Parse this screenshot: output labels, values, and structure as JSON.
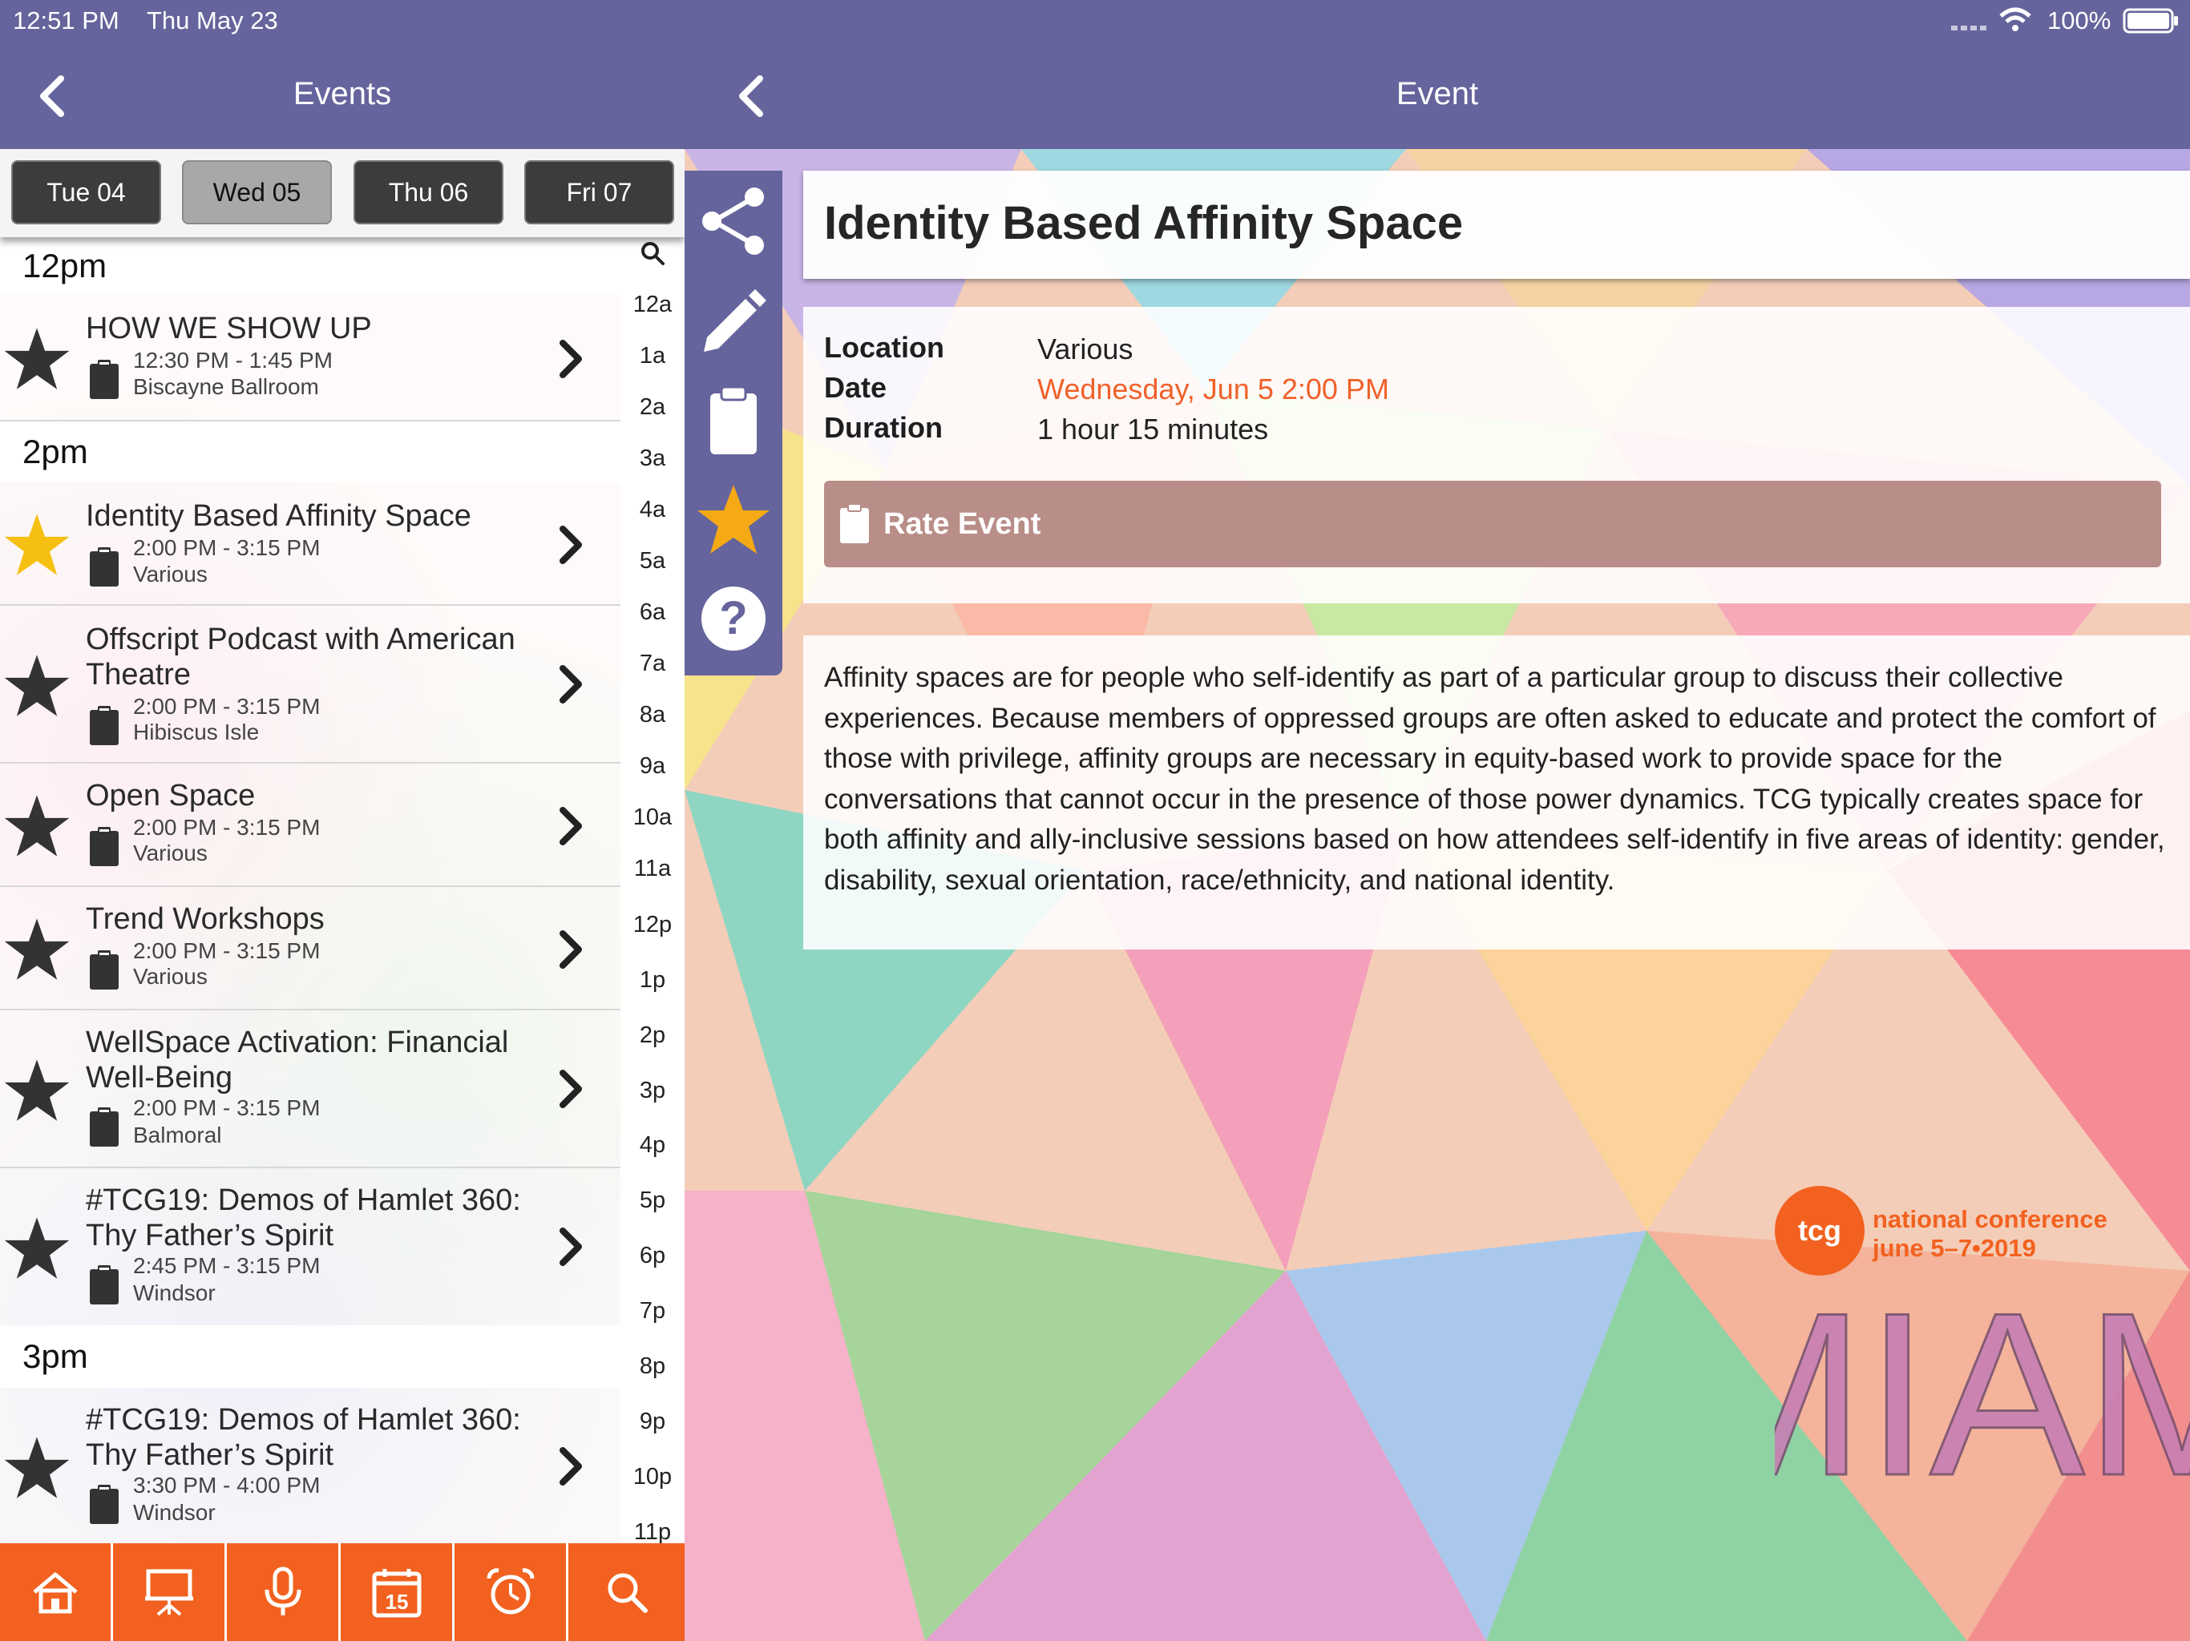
{
  "status_bar": {
    "time": "12:51 PM",
    "date": "Thu May 23",
    "battery": "100%"
  },
  "left_header": {
    "title": "Events"
  },
  "day_tabs": [
    {
      "label": "Tue 04",
      "active": false
    },
    {
      "label": "Wed 05",
      "active": true
    },
    {
      "label": "Thu 06",
      "active": false
    },
    {
      "label": "Fri 07",
      "active": false
    }
  ],
  "sections": [
    {
      "header": "12pm",
      "events": [
        {
          "title": "HOW WE SHOW UP",
          "time": "12:30 PM - 1:45 PM",
          "location": "Biscayne Ballroom",
          "starred": false
        }
      ]
    },
    {
      "header": "2pm",
      "events": [
        {
          "title": "Identity Based Affinity Space",
          "time": "2:00 PM - 3:15 PM",
          "location": "Various",
          "starred": true
        },
        {
          "title": "Offscript Podcast with American Theatre",
          "time": "2:00 PM - 3:15 PM",
          "location": "Hibiscus Isle",
          "starred": false
        },
        {
          "title": "Open Space",
          "time": "2:00 PM - 3:15 PM",
          "location": "Various",
          "starred": false
        },
        {
          "title": "Trend Workshops",
          "time": "2:00 PM - 3:15 PM",
          "location": "Various",
          "starred": false
        },
        {
          "title": "WellSpace Activation: Financial Well-Being",
          "time": "2:00 PM - 3:15 PM",
          "location": "Balmoral",
          "starred": false
        },
        {
          "title": "#TCG19: Demos of Hamlet 360: Thy Father’s Spirit",
          "time": "2:45 PM - 3:15 PM",
          "location": "Windsor",
          "starred": false
        }
      ]
    },
    {
      "header": "3pm",
      "events": [
        {
          "title": "#TCG19: Demos of Hamlet 360: Thy Father’s Spirit",
          "time": "3:30 PM - 4:00 PM",
          "location": "Windsor",
          "starred": false
        }
      ]
    }
  ],
  "time_index": [
    "12a",
    "1a",
    "2a",
    "3a",
    "4a",
    "5a",
    "6a",
    "7a",
    "8a",
    "9a",
    "10a",
    "11a",
    "12p",
    "1p",
    "2p",
    "3p",
    "4p",
    "5p",
    "6p",
    "7p",
    "8p",
    "9p",
    "10p",
    "11p"
  ],
  "tab_bar": [
    "home-icon",
    "presentation-icon",
    "microphone-icon",
    "calendar-icon",
    "alarm-clock-icon",
    "search-icon"
  ],
  "tab_bar_calendar_day": "15",
  "right_header": {
    "title": "Event"
  },
  "side_toolbar": [
    "share-icon",
    "pencil-icon",
    "clipboard-icon",
    "star-icon",
    "help-icon"
  ],
  "event_detail": {
    "title": "Identity Based Affinity Space",
    "location_label": "Location",
    "location": "Various",
    "date_label": "Date",
    "date": "Wednesday, Jun 5 2:00 PM",
    "duration_label": "Duration",
    "duration": "1 hour 15 minutes",
    "rate_button": "Rate Event",
    "description": "Affinity spaces are for people who self-identify as part of a particular group to discuss their collective experiences. Because members of oppressed groups are often asked to educate and protect the comfort of those with privilege, affinity groups are necessary in equity-based work to provide space for the conversations that cannot occur in the presence of those power dynamics. TCG typically creates space for both affinity and ally-inclusive sessions based on how attendees self-identify in five areas of identity: gender, disability, sexual orientation, race/ethnicity, and national identity."
  },
  "logo": {
    "brand": "tcg",
    "line1": "national conference",
    "line2": "june 5–7•2019",
    "city": "MIAMI"
  },
  "colors": {
    "header": "#65649c",
    "tab_bar": "#f2611f",
    "date_text": "#f0612a",
    "star_active": "#f5c012",
    "rate_button": "#b98d88"
  }
}
